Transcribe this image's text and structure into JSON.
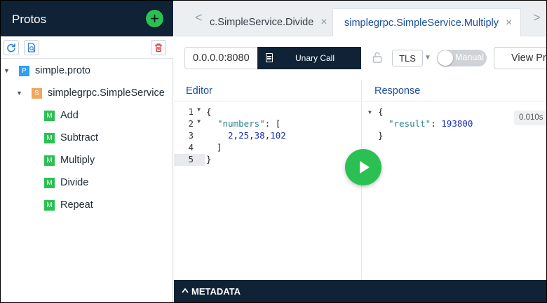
{
  "sidebar": {
    "title": "Protos",
    "toolbar": {
      "reload_icon": "reload-icon",
      "import_icon": "file-search-icon",
      "delete_icon": "trash-icon"
    },
    "tree": {
      "proto_badge": "P",
      "proto_file": "simple.proto",
      "service_badge": "S",
      "service": "simplegrpc.SimpleService",
      "method_badge": "M",
      "methods": [
        "Add",
        "Subtract",
        "Multiply",
        "Divide",
        "Repeat"
      ]
    }
  },
  "tabs": {
    "prev_arrow": "<",
    "next_arrow": ">",
    "close_glyph": "×",
    "items": [
      {
        "label": "c.SimpleService.Divide",
        "active": false
      },
      {
        "label": "simplegrpc.SimpleService.Multiply",
        "active": true
      }
    ]
  },
  "address": {
    "value": "0.0.0.0:8080",
    "call_type": "Unary Call",
    "tls_label": "TLS",
    "mode_label": "Manual",
    "view_label": "View Proto"
  },
  "editor": {
    "title": "Editor",
    "line_numbers": [
      "1",
      "2",
      "3",
      "4",
      "5"
    ],
    "lines": {
      "l1": "{",
      "l2_key": "\"numbers\"",
      "l2_rest": ": [",
      "l3_values": [
        "2",
        "25",
        "38",
        "102"
      ],
      "l4": "]",
      "l5": "}"
    }
  },
  "response": {
    "title": "Response",
    "time": "0.010s",
    "open": "{",
    "key": "\"result\"",
    "colon": ": ",
    "value": "193800",
    "close": "}"
  },
  "metadata": {
    "label": "METADATA"
  },
  "colors": {
    "navy": "#0f2236",
    "green": "#2bc152",
    "link_blue": "#1a4fa0"
  }
}
